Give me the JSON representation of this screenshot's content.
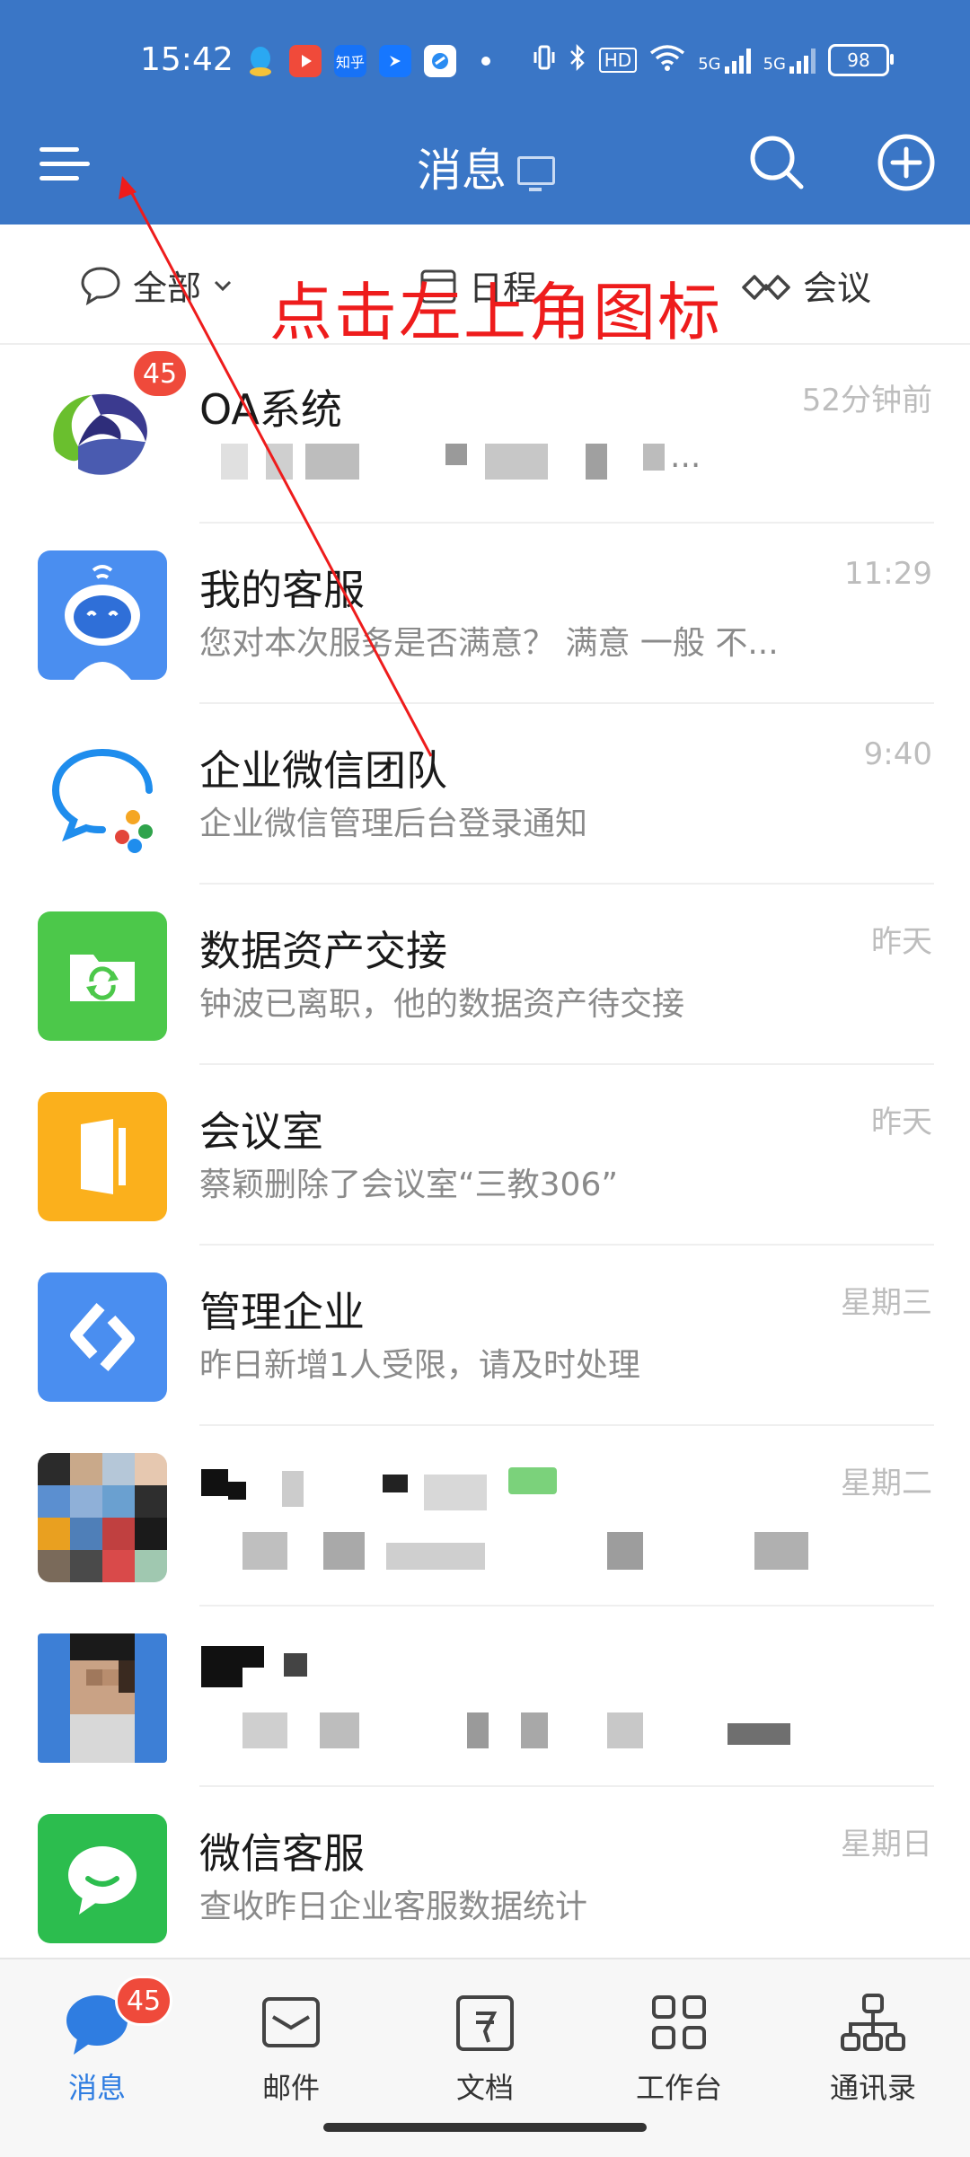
{
  "status_bar": {
    "time": "15:42",
    "app_icons": [
      "qq-icon",
      "video-icon",
      "zhihu-icon",
      "feishu-icon",
      "app-icon"
    ],
    "zhihu_label": "知乎",
    "hd_label": "HD",
    "net1": "5G",
    "net2": "5G",
    "battery": "98"
  },
  "header": {
    "title": "消息"
  },
  "filters": {
    "all": "全部",
    "schedule": "日程",
    "meeting": "会议"
  },
  "annotation": {
    "text": "点击左上角图标",
    "color": "#ee1c1c"
  },
  "messages": [
    {
      "name": "OA系统",
      "preview": "",
      "time": "52分钟前",
      "badge": "45",
      "icon": "oa-logo-icon"
    },
    {
      "name": "我的客服",
      "preview": "您对本次服务是否满意？  满意  一般  不...",
      "time": "11:29",
      "icon": "robot-icon"
    },
    {
      "name": "企业微信团队",
      "preview": "企业微信管理后台登录通知",
      "time": "9:40",
      "icon": "wecom-logo-icon"
    },
    {
      "name": "数据资产交接",
      "preview": "钟波已离职，他的数据资产待交接",
      "time": "昨天",
      "icon": "folder-sync-icon"
    },
    {
      "name": "会议室",
      "preview": "蔡颖删除了会议室“三教306”",
      "time": "昨天",
      "icon": "door-icon"
    },
    {
      "name": "管理企业",
      "preview": "昨日新增1人受限，请及时处理",
      "time": "星期三",
      "icon": "manage-icon"
    },
    {
      "name": "",
      "preview": "",
      "time": "星期二",
      "icon": "group-avatar-icon"
    },
    {
      "name": "",
      "preview": "",
      "time": "",
      "icon": "person-avatar-icon"
    },
    {
      "name": "微信客服",
      "preview": "查收昨日企业客服数据统计",
      "time": "星期日",
      "icon": "chat-bubble-icon"
    }
  ],
  "tabs": [
    {
      "label": "消息",
      "badge": "45",
      "icon": "message-icon",
      "active": true
    },
    {
      "label": "邮件",
      "icon": "mail-icon"
    },
    {
      "label": "文档",
      "icon": "doc-icon"
    },
    {
      "label": "工作台",
      "icon": "grid-icon"
    },
    {
      "label": "通讯录",
      "icon": "contacts-icon"
    }
  ],
  "colors": {
    "header_bg": "#3a76c6",
    "accent": "#3a76c6",
    "badge": "#ef4a3b"
  }
}
